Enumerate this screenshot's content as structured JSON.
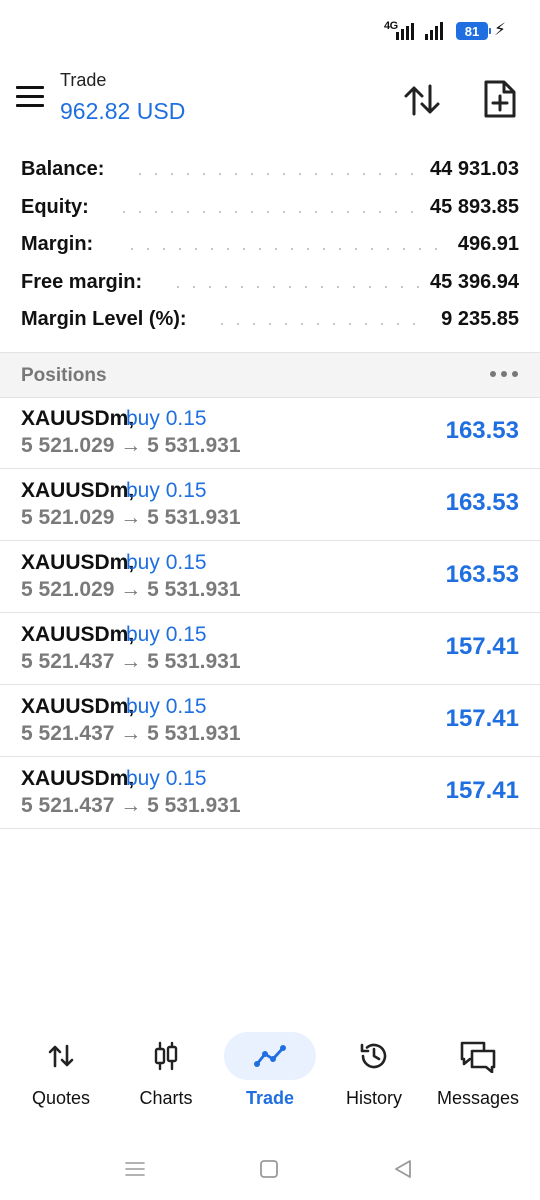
{
  "status_bar": {
    "network_label": "4G",
    "battery_level": "81"
  },
  "header": {
    "title": "Trade",
    "balance_display": "962.82 USD"
  },
  "account": [
    {
      "label": "Balance:",
      "value": "44 931.03"
    },
    {
      "label": "Equity:",
      "value": "45 893.85"
    },
    {
      "label": "Margin:",
      "value": "496.91"
    },
    {
      "label": "Free margin:",
      "value": "45 396.94"
    },
    {
      "label": "Margin Level (%):",
      "value": "9 235.85"
    }
  ],
  "positions_section": {
    "title": "Positions"
  },
  "positions": [
    {
      "symbol": "XAUUSDm,",
      "side": "buy 0.15",
      "prices": "5 521.029 → 5 531.931",
      "profit": "163.53"
    },
    {
      "symbol": "XAUUSDm,",
      "side": "buy 0.15",
      "prices": "5 521.029 → 5 531.931",
      "profit": "163.53"
    },
    {
      "symbol": "XAUUSDm,",
      "side": "buy 0.15",
      "prices": "5 521.029 → 5 531.931",
      "profit": "163.53"
    },
    {
      "symbol": "XAUUSDm,",
      "side": "buy 0.15",
      "prices": "5 521.437 → 5 531.931",
      "profit": "157.41"
    },
    {
      "symbol": "XAUUSDm,",
      "side": "buy 0.15",
      "prices": "5 521.437 → 5 531.931",
      "profit": "157.41"
    },
    {
      "symbol": "XAUUSDm,",
      "side": "buy 0.15",
      "prices": "5 521.437 → 5 531.931",
      "profit": "157.41"
    }
  ],
  "bottom_nav": [
    {
      "label": "Quotes",
      "icon": "quotes-arrows-icon"
    },
    {
      "label": "Charts",
      "icon": "candlestick-icon"
    },
    {
      "label": "Trade",
      "icon": "trade-line-icon",
      "active": true
    },
    {
      "label": "History",
      "icon": "history-clock-icon"
    },
    {
      "label": "Messages",
      "icon": "chat-bubbles-icon"
    }
  ],
  "colors": {
    "accent": "#1f6fe0",
    "text": "#111111",
    "muted": "#7a7a7a"
  }
}
